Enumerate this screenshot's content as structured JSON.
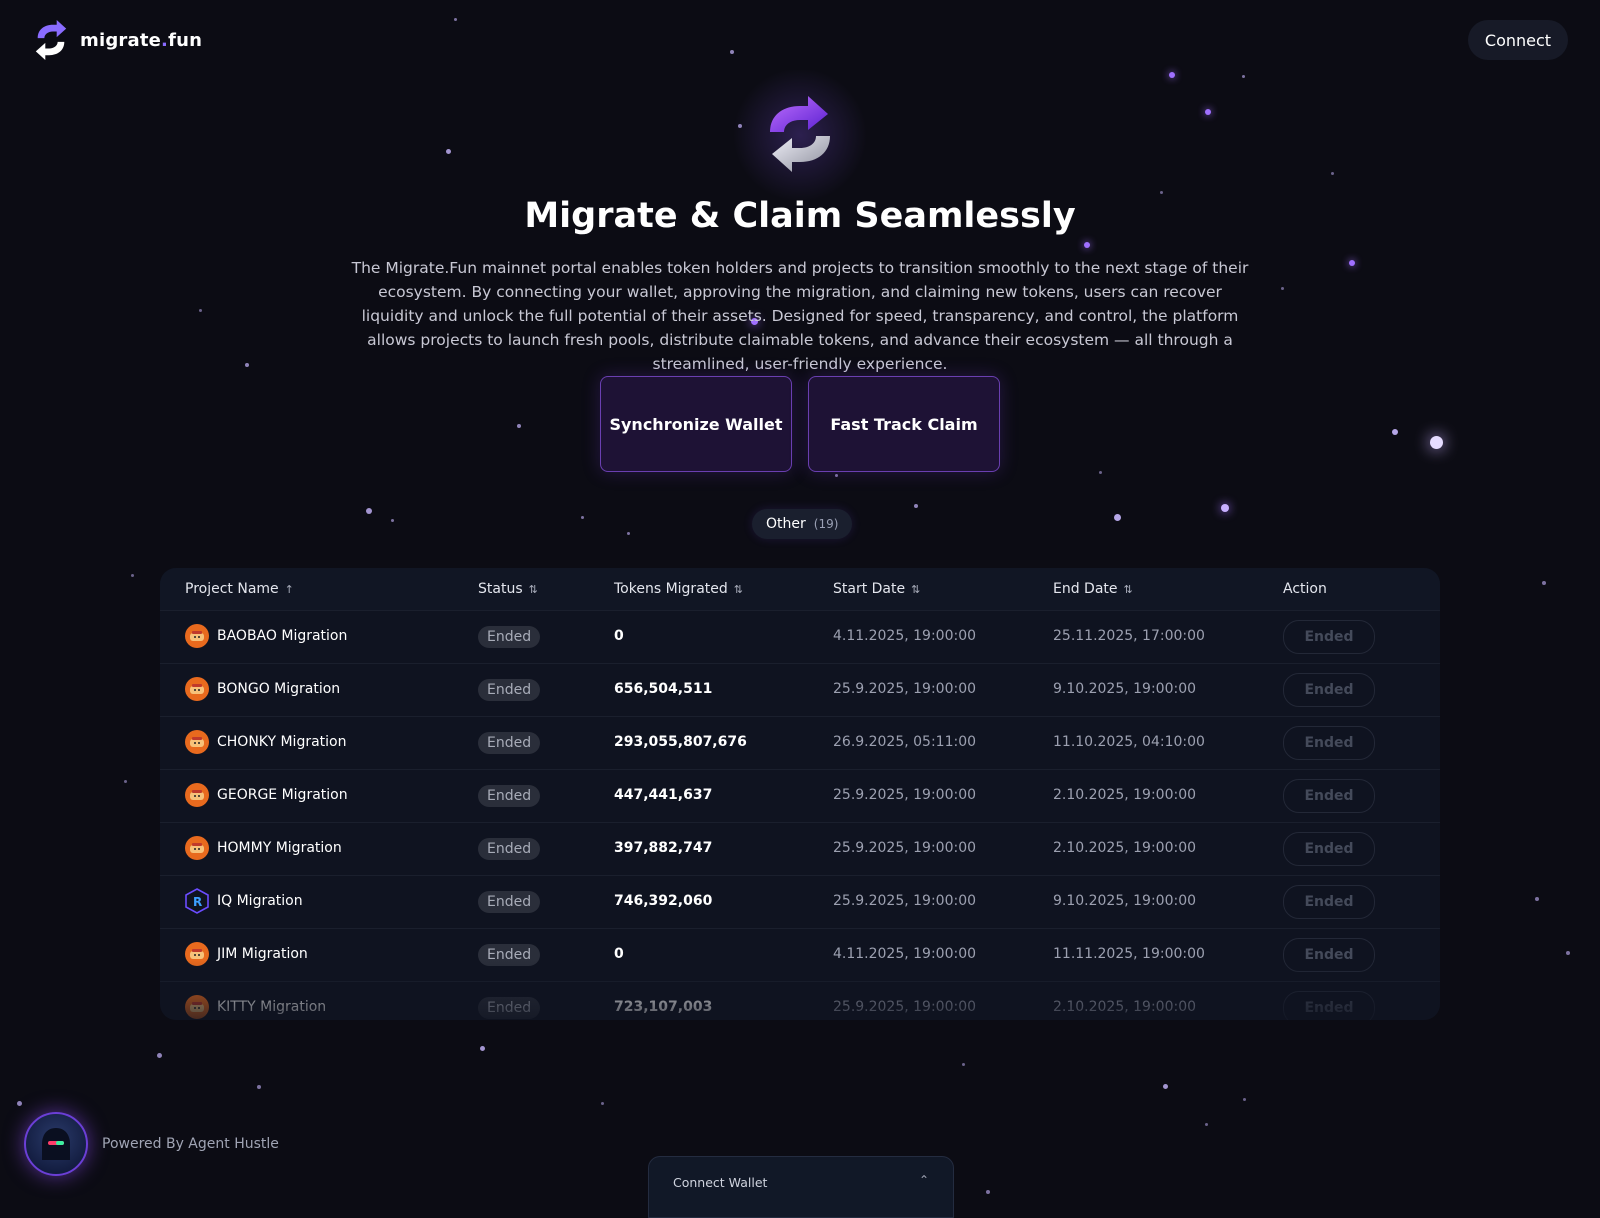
{
  "header": {
    "logo_main": "migrate",
    "logo_dot": ".",
    "logo_suffix": "fun",
    "connect_label": "Connect"
  },
  "hero": {
    "title": "Migrate & Claim Seamlessly",
    "description": "The Migrate.Fun mainnet portal enables token holders and projects to transition smoothly to the next stage of their ecosystem. By connecting your wallet, approving the migration, and claiming new tokens, users can recover liquidity and unlock the full potential of their assets. Designed for speed, transparency, and control, the platform allows projects to launch fresh pools, distribute claimable tokens, and advance their ecosystem — all through a streamlined, user-friendly experience.",
    "buttons": {
      "sync": "Synchronize Wallet",
      "fast": "Fast Track Claim"
    }
  },
  "filter": {
    "label": "Other",
    "count": "(19)"
  },
  "table": {
    "headers": {
      "project": "Project Name",
      "status": "Status",
      "tokens": "Tokens Migrated",
      "start": "Start Date",
      "end": "End Date",
      "action": "Action"
    },
    "sort_icons": {
      "project": "↑",
      "status": "⇅",
      "tokens": "⇅",
      "start": "⇅",
      "end": "⇅"
    },
    "rows": [
      {
        "name": "BAOBAO Migration",
        "status": "Ended",
        "tokens": "0",
        "start": "4.11.2025, 19:00:00",
        "end": "25.11.2025, 17:00:00",
        "action": "Ended",
        "icon": "dog-avatar-icon"
      },
      {
        "name": "BONGO Migration",
        "status": "Ended",
        "tokens": "656,504,511",
        "start": "25.9.2025, 19:00:00",
        "end": "9.10.2025, 19:00:00",
        "action": "Ended",
        "icon": "dog-avatar-icon"
      },
      {
        "name": "CHONKY Migration",
        "status": "Ended",
        "tokens": "293,055,807,676",
        "start": "26.9.2025, 05:11:00",
        "end": "11.10.2025, 04:10:00",
        "action": "Ended",
        "icon": "dog-avatar-icon"
      },
      {
        "name": "GEORGE Migration",
        "status": "Ended",
        "tokens": "447,441,637",
        "start": "25.9.2025, 19:00:00",
        "end": "2.10.2025, 19:00:00",
        "action": "Ended",
        "icon": "dog-avatar-icon"
      },
      {
        "name": "HOMMY Migration",
        "status": "Ended",
        "tokens": "397,882,747",
        "start": "25.9.2025, 19:00:00",
        "end": "2.10.2025, 19:00:00",
        "action": "Ended",
        "icon": "dog-avatar-icon"
      },
      {
        "name": "IQ Migration",
        "status": "Ended",
        "tokens": "746,392,060",
        "start": "25.9.2025, 19:00:00",
        "end": "9.10.2025, 19:00:00",
        "action": "Ended",
        "icon": "iq-hexagon-icon"
      },
      {
        "name": "JIM Migration",
        "status": "Ended",
        "tokens": "0",
        "start": "4.11.2025, 19:00:00",
        "end": "11.11.2025, 19:00:00",
        "action": "Ended",
        "icon": "dog-avatar-icon"
      },
      {
        "name": "KITTY Migration",
        "status": "Ended",
        "tokens": "723,107,003",
        "start": "25.9.2025, 19:00:00",
        "end": "2.10.2025, 19:00:00",
        "action": "Ended",
        "icon": "dog-avatar-icon"
      }
    ]
  },
  "footer": {
    "powered_by": "Powered By Agent Hustle",
    "wallet_drawer_label": "Connect Wallet",
    "wallet_drawer_chevron": "⌃"
  },
  "colors": {
    "background": "#0c0c14",
    "accent_purple": "#8a6cff",
    "button_bg": "#1e1235",
    "button_border": "#6a3fb0"
  }
}
